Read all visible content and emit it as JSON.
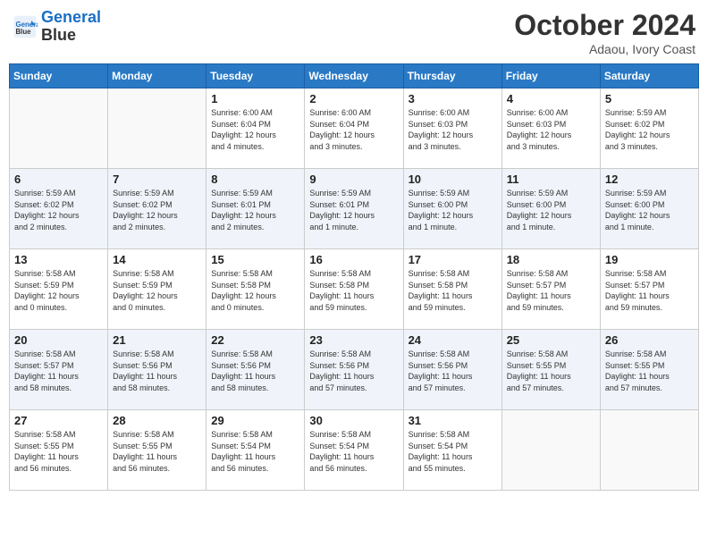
{
  "header": {
    "logo_line1": "General",
    "logo_line2": "Blue",
    "month": "October 2024",
    "location": "Adaou, Ivory Coast"
  },
  "weekdays": [
    "Sunday",
    "Monday",
    "Tuesday",
    "Wednesday",
    "Thursday",
    "Friday",
    "Saturday"
  ],
  "weeks": [
    [
      {
        "day": "",
        "info": ""
      },
      {
        "day": "",
        "info": ""
      },
      {
        "day": "1",
        "info": "Sunrise: 6:00 AM\nSunset: 6:04 PM\nDaylight: 12 hours\nand 4 minutes."
      },
      {
        "day": "2",
        "info": "Sunrise: 6:00 AM\nSunset: 6:04 PM\nDaylight: 12 hours\nand 3 minutes."
      },
      {
        "day": "3",
        "info": "Sunrise: 6:00 AM\nSunset: 6:03 PM\nDaylight: 12 hours\nand 3 minutes."
      },
      {
        "day": "4",
        "info": "Sunrise: 6:00 AM\nSunset: 6:03 PM\nDaylight: 12 hours\nand 3 minutes."
      },
      {
        "day": "5",
        "info": "Sunrise: 5:59 AM\nSunset: 6:02 PM\nDaylight: 12 hours\nand 3 minutes."
      }
    ],
    [
      {
        "day": "6",
        "info": "Sunrise: 5:59 AM\nSunset: 6:02 PM\nDaylight: 12 hours\nand 2 minutes."
      },
      {
        "day": "7",
        "info": "Sunrise: 5:59 AM\nSunset: 6:02 PM\nDaylight: 12 hours\nand 2 minutes."
      },
      {
        "day": "8",
        "info": "Sunrise: 5:59 AM\nSunset: 6:01 PM\nDaylight: 12 hours\nand 2 minutes."
      },
      {
        "day": "9",
        "info": "Sunrise: 5:59 AM\nSunset: 6:01 PM\nDaylight: 12 hours\nand 1 minute."
      },
      {
        "day": "10",
        "info": "Sunrise: 5:59 AM\nSunset: 6:00 PM\nDaylight: 12 hours\nand 1 minute."
      },
      {
        "day": "11",
        "info": "Sunrise: 5:59 AM\nSunset: 6:00 PM\nDaylight: 12 hours\nand 1 minute."
      },
      {
        "day": "12",
        "info": "Sunrise: 5:59 AM\nSunset: 6:00 PM\nDaylight: 12 hours\nand 1 minute."
      }
    ],
    [
      {
        "day": "13",
        "info": "Sunrise: 5:58 AM\nSunset: 5:59 PM\nDaylight: 12 hours\nand 0 minutes."
      },
      {
        "day": "14",
        "info": "Sunrise: 5:58 AM\nSunset: 5:59 PM\nDaylight: 12 hours\nand 0 minutes."
      },
      {
        "day": "15",
        "info": "Sunrise: 5:58 AM\nSunset: 5:58 PM\nDaylight: 12 hours\nand 0 minutes."
      },
      {
        "day": "16",
        "info": "Sunrise: 5:58 AM\nSunset: 5:58 PM\nDaylight: 11 hours\nand 59 minutes."
      },
      {
        "day": "17",
        "info": "Sunrise: 5:58 AM\nSunset: 5:58 PM\nDaylight: 11 hours\nand 59 minutes."
      },
      {
        "day": "18",
        "info": "Sunrise: 5:58 AM\nSunset: 5:57 PM\nDaylight: 11 hours\nand 59 minutes."
      },
      {
        "day": "19",
        "info": "Sunrise: 5:58 AM\nSunset: 5:57 PM\nDaylight: 11 hours\nand 59 minutes."
      }
    ],
    [
      {
        "day": "20",
        "info": "Sunrise: 5:58 AM\nSunset: 5:57 PM\nDaylight: 11 hours\nand 58 minutes."
      },
      {
        "day": "21",
        "info": "Sunrise: 5:58 AM\nSunset: 5:56 PM\nDaylight: 11 hours\nand 58 minutes."
      },
      {
        "day": "22",
        "info": "Sunrise: 5:58 AM\nSunset: 5:56 PM\nDaylight: 11 hours\nand 58 minutes."
      },
      {
        "day": "23",
        "info": "Sunrise: 5:58 AM\nSunset: 5:56 PM\nDaylight: 11 hours\nand 57 minutes."
      },
      {
        "day": "24",
        "info": "Sunrise: 5:58 AM\nSunset: 5:56 PM\nDaylight: 11 hours\nand 57 minutes."
      },
      {
        "day": "25",
        "info": "Sunrise: 5:58 AM\nSunset: 5:55 PM\nDaylight: 11 hours\nand 57 minutes."
      },
      {
        "day": "26",
        "info": "Sunrise: 5:58 AM\nSunset: 5:55 PM\nDaylight: 11 hours\nand 57 minutes."
      }
    ],
    [
      {
        "day": "27",
        "info": "Sunrise: 5:58 AM\nSunset: 5:55 PM\nDaylight: 11 hours\nand 56 minutes."
      },
      {
        "day": "28",
        "info": "Sunrise: 5:58 AM\nSunset: 5:55 PM\nDaylight: 11 hours\nand 56 minutes."
      },
      {
        "day": "29",
        "info": "Sunrise: 5:58 AM\nSunset: 5:54 PM\nDaylight: 11 hours\nand 56 minutes."
      },
      {
        "day": "30",
        "info": "Sunrise: 5:58 AM\nSunset: 5:54 PM\nDaylight: 11 hours\nand 56 minutes."
      },
      {
        "day": "31",
        "info": "Sunrise: 5:58 AM\nSunset: 5:54 PM\nDaylight: 11 hours\nand 55 minutes."
      },
      {
        "day": "",
        "info": ""
      },
      {
        "day": "",
        "info": ""
      }
    ]
  ]
}
